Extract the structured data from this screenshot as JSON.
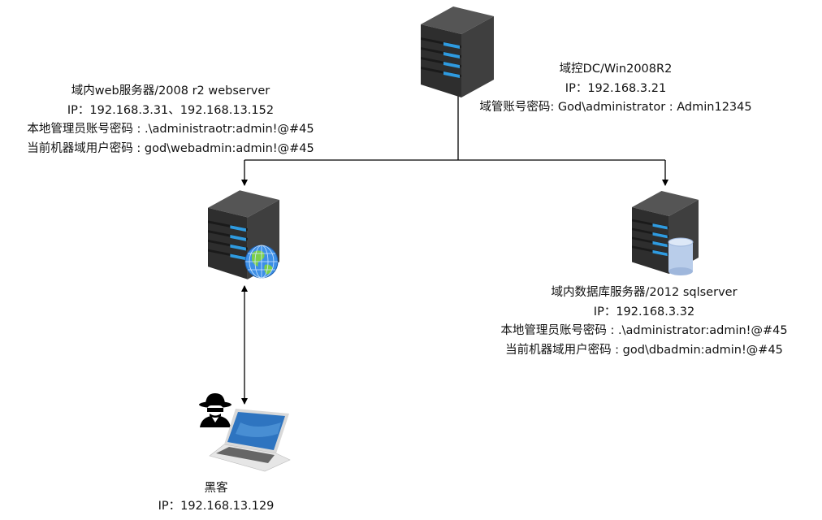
{
  "nodes": {
    "dc": {
      "icon": "server-icon",
      "lines": [
        "域控DC/Win2008R2",
        "IP：192.168.3.21",
        "域管账号密码: God\\administrator : Admin12345"
      ]
    },
    "web": {
      "icon": "web-server-icon",
      "lines": [
        "域内web服务器/2008 r2 webserver",
        "IP：192.168.3.31、192.168.13.152",
        "本地管理员账号密码 : .\\administraotr:admin!@#45",
        "当前机器域用户密码 : god\\webadmin:admin!@#45"
      ]
    },
    "db": {
      "icon": "database-server-icon",
      "lines": [
        "域内数据库服务器/2012 sqlserver",
        "IP：192.168.3.32",
        "本地管理员账号密码 : .\\administrator:admin!@#45",
        "当前机器域用户密码 : god\\dbadmin:admin!@#45"
      ]
    },
    "hacker": {
      "icon": "hacker-laptop-icon",
      "lines": [
        "黑客",
        "IP：192.168.13.129"
      ]
    }
  },
  "colors": {
    "server_body": "#3a3a3a",
    "led": "#2f9be0",
    "line": "#000000"
  }
}
